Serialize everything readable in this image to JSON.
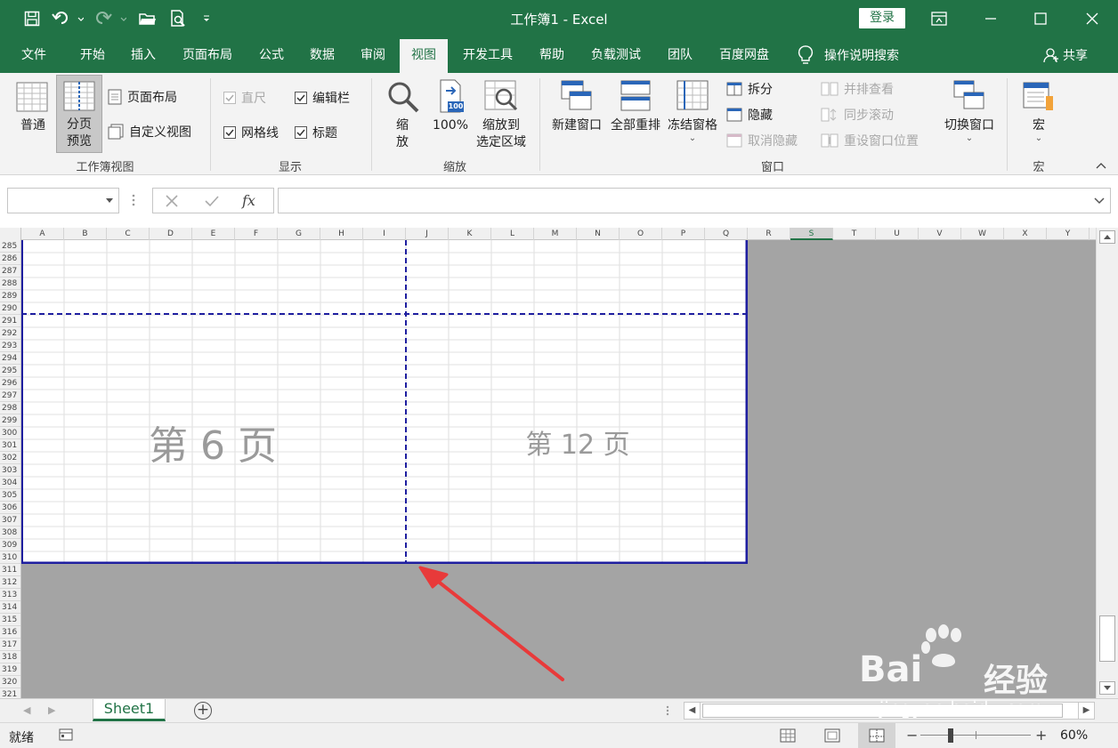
{
  "window": {
    "title": "工作簿1 - Excel",
    "login_label": "登录"
  },
  "tabs": [
    {
      "label": "文件"
    },
    {
      "label": "开始"
    },
    {
      "label": "插入"
    },
    {
      "label": "页面布局"
    },
    {
      "label": "公式"
    },
    {
      "label": "数据"
    },
    {
      "label": "审阅"
    },
    {
      "label": "视图",
      "active": true
    },
    {
      "label": "开发工具"
    },
    {
      "label": "帮助"
    },
    {
      "label": "负载测试"
    },
    {
      "label": "团队"
    },
    {
      "label": "百度网盘"
    }
  ],
  "tellme": {
    "label": "操作说明搜索"
  },
  "share": {
    "label": "共享"
  },
  "ribbon": {
    "workbook_views": {
      "label": "工作簿视图",
      "normal": "普通",
      "page_break_1": "分页",
      "page_break_2": "预览",
      "page_layout": "页面布局",
      "custom_views": "自定义视图"
    },
    "show": {
      "label": "显示",
      "ruler": "直尺",
      "formula_bar": "编辑栏",
      "gridlines": "网格线",
      "headings": "标题"
    },
    "zoom": {
      "label": "缩放",
      "zoom_1": "缩",
      "zoom_2": "放",
      "hundred": "100%",
      "hundred_icon_text": "100",
      "zoom_sel_1": "缩放到",
      "zoom_sel_2": "选定区域"
    },
    "window": {
      "label": "窗口",
      "new_window": "新建窗口",
      "arrange_all": "全部重排",
      "freeze": "冻结窗格",
      "split": "拆分",
      "hide": "隐藏",
      "unhide": "取消隐藏",
      "side_by_side": "并排查看",
      "sync_scroll": "同步滚动",
      "reset_pos": "重设窗口位置",
      "switch": "切换窗口"
    },
    "macros": {
      "label": "宏",
      "macros": "宏"
    }
  },
  "formula_bar": {
    "name_box": "",
    "formula": "",
    "fx": "fx"
  },
  "grid": {
    "columns": [
      "A",
      "B",
      "C",
      "D",
      "E",
      "F",
      "G",
      "H",
      "I",
      "J",
      "K",
      "L",
      "M",
      "N",
      "O",
      "P",
      "Q",
      "R",
      "S",
      "T",
      "U",
      "V",
      "W",
      "X",
      "Y"
    ],
    "selected_column": "S",
    "rows": [
      "285",
      "286",
      "287",
      "288",
      "289",
      "290",
      "291",
      "292",
      "293",
      "294",
      "295",
      "296",
      "297",
      "298",
      "299",
      "300",
      "301",
      "302",
      "303",
      "304",
      "305",
      "306",
      "307",
      "308",
      "309",
      "310",
      "311",
      "312",
      "313",
      "314",
      "315",
      "316",
      "317",
      "318",
      "319",
      "320",
      "321"
    ],
    "page_left": "第 6 页",
    "page_right": "第 12 页"
  },
  "sheets": [
    {
      "name": "Sheet1"
    }
  ],
  "status": {
    "ready": "就绪",
    "zoom": "60%",
    "zoom_fraction": 0.6
  },
  "watermark": {
    "brand": "Bai",
    "brand2": "经验",
    "url": "jingyan.baidu.com"
  },
  "colors": {
    "excel_green": "#217346",
    "page_break_blue": "#1f1fa0",
    "arrow_red": "#e83a3a"
  }
}
